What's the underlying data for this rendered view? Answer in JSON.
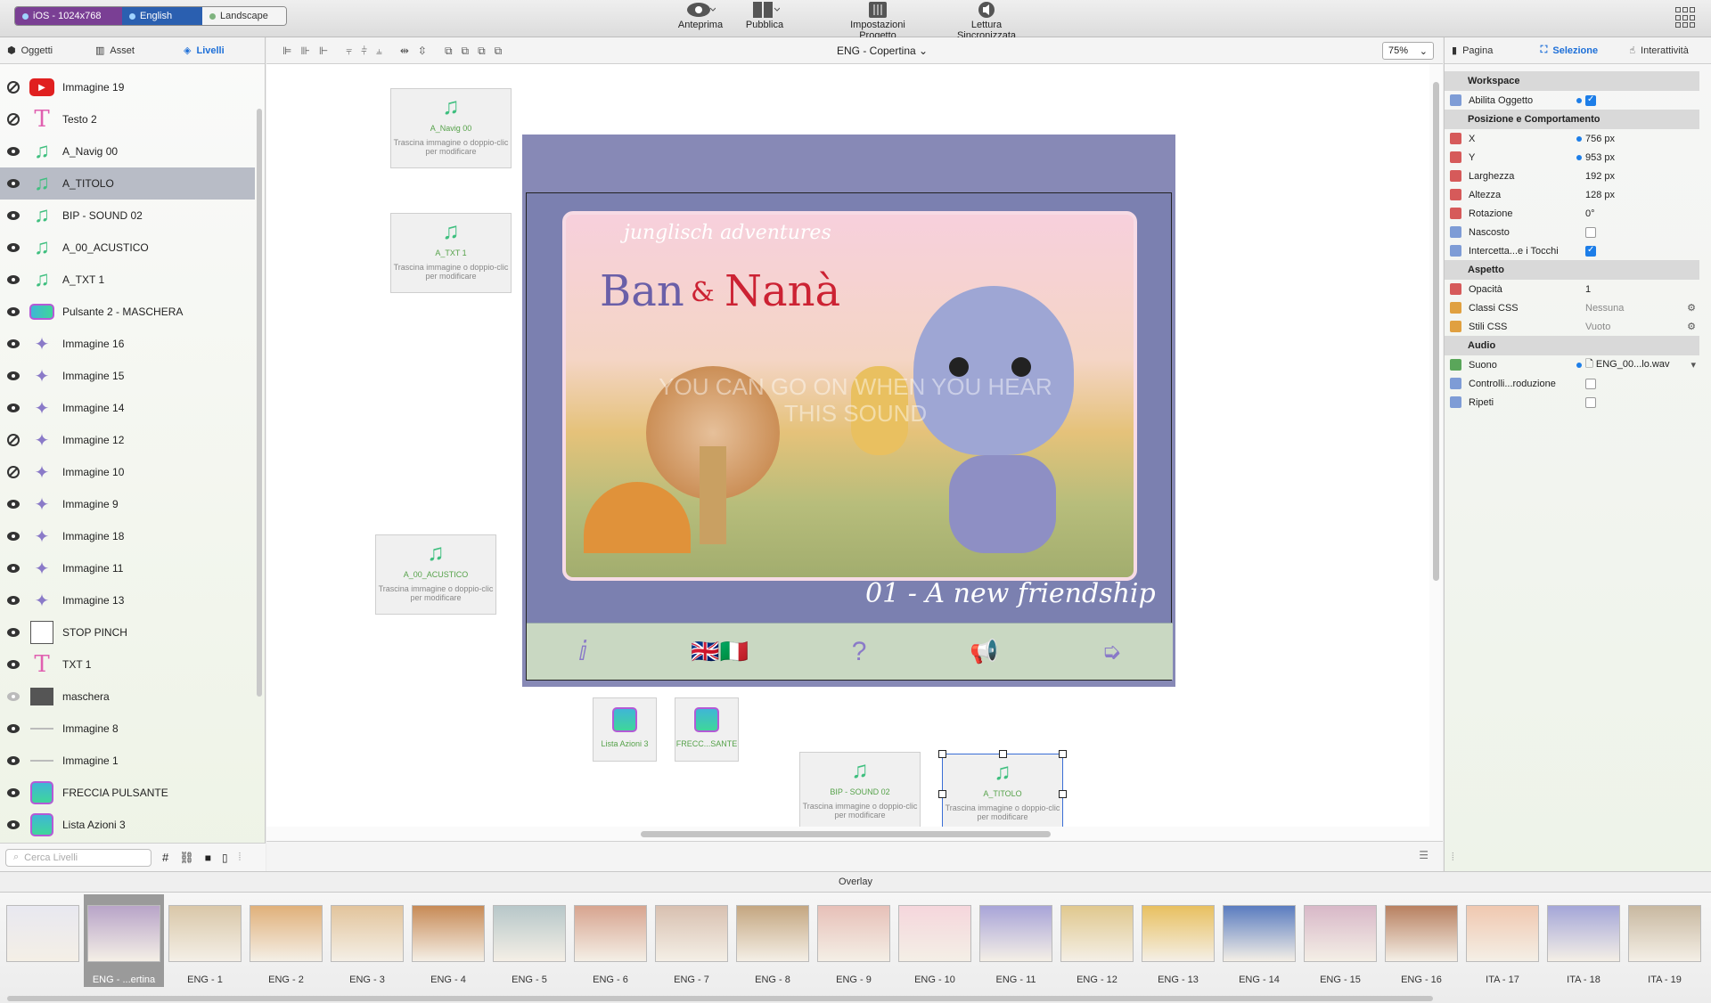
{
  "toolbar": {
    "device": "iOS - 1024x768",
    "language": "English",
    "orientation": "Landscape",
    "preview": "Anteprima",
    "publish": "Pubblica",
    "project_settings": "Impostazioni Progetto",
    "sync_reading": "Lettura Sincronizzata"
  },
  "left_tabs": [
    "Oggetti",
    "Asset",
    "Livelli"
  ],
  "layers": [
    {
      "name": "Immagine 19",
      "type": "youtube",
      "vis": "off"
    },
    {
      "name": "Testo 2",
      "type": "text",
      "vis": "off"
    },
    {
      "name": "A_Navig 00",
      "type": "sound",
      "vis": "on"
    },
    {
      "name": "A_TITOLO",
      "type": "sound",
      "vis": "on",
      "selected": true
    },
    {
      "name": "BIP - SOUND 02",
      "type": "sound",
      "vis": "on"
    },
    {
      "name": "A_00_ACUSTICO",
      "type": "sound",
      "vis": "on"
    },
    {
      "name": "A_TXT 1",
      "type": "sound",
      "vis": "on"
    },
    {
      "name": "Pulsante 2 - MASCHERA",
      "type": "button",
      "vis": "on"
    },
    {
      "name": "Immagine 16",
      "type": "img",
      "vis": "on"
    },
    {
      "name": "Immagine 15",
      "type": "img",
      "vis": "on"
    },
    {
      "name": "Immagine 14",
      "type": "img",
      "vis": "on"
    },
    {
      "name": "Immagine 12",
      "type": "img",
      "vis": "off"
    },
    {
      "name": "Immagine 10",
      "type": "img",
      "vis": "off"
    },
    {
      "name": "Immagine 9",
      "type": "img",
      "vis": "on"
    },
    {
      "name": "Immagine 18",
      "type": "img",
      "vis": "on"
    },
    {
      "name": "Immagine 11",
      "type": "img",
      "vis": "on"
    },
    {
      "name": "Immagine 13",
      "type": "img",
      "vis": "on"
    },
    {
      "name": "STOP PINCH",
      "type": "box",
      "vis": "on"
    },
    {
      "name": "TXT 1",
      "type": "text",
      "vis": "on"
    },
    {
      "name": "maschera",
      "type": "dark",
      "vis": "dim"
    },
    {
      "name": "Immagine 8",
      "type": "line",
      "vis": "on"
    },
    {
      "name": "Immagine 1",
      "type": "line",
      "vis": "on"
    },
    {
      "name": "FRECCIA PULSANTE",
      "type": "list",
      "vis": "on"
    },
    {
      "name": "Lista Azioni 3",
      "type": "list",
      "vis": "on"
    }
  ],
  "search_placeholder": "Cerca Livelli",
  "page_name": "ENG - Copertina",
  "zoom": "75%",
  "widgets": {
    "drop_hint": "Trascina immagine o doppio-clic per modificare",
    "navig": "A_Navig 00",
    "txt1": "A_TXT 1",
    "acustico": "A_00_ACUSTICO",
    "bip": "BIP - SOUND 02",
    "titolo": "A_TITOLO",
    "lista": "Lista Azioni 3",
    "frecc": "FRECC...SANTE"
  },
  "stage": {
    "subtitle": "junglisch adventures",
    "title_left": "Ban",
    "title_amp": "&",
    "title_right": "Nanà",
    "ghost_text": "YOU CAN GO ON WHEN YOU HEAR THIS SOUND",
    "episode": "01 - A new friendship"
  },
  "right_tabs": [
    "Pagina",
    "Selezione",
    "Interattività"
  ],
  "props": {
    "workspace": "Workspace",
    "enable_object": "Abilita Oggetto",
    "position_behaviour": "Posizione e Comportamento",
    "x_label": "X",
    "x_val": "756 px",
    "y_label": "Y",
    "y_val": "953 px",
    "w_label": "Larghezza",
    "w_val": "192 px",
    "h_label": "Altezza",
    "h_val": "128 px",
    "rot_label": "Rotazione",
    "rot_val": "0°",
    "hidden_label": "Nascosto",
    "touch_label": "Intercetta...e i Tocchi",
    "appearance": "Aspetto",
    "opacity_label": "Opacità",
    "opacity_val": "1",
    "css_class_label": "Classi CSS",
    "css_class_val": "Nessuna",
    "css_style_label": "Stili CSS",
    "css_style_val": "Vuoto",
    "audio": "Audio",
    "sound_label": "Suono",
    "sound_val": "ENG_00...lo.wav",
    "controls_label": "Controlli...roduzione",
    "repeat_label": "Ripeti"
  },
  "overlay": "Overlay",
  "pages": [
    "",
    "ENG - ...ertina",
    "ENG - 1",
    "ENG - 2",
    "ENG - 3",
    "ENG - 4",
    "ENG - 5",
    "ENG - 6",
    "ENG - 7",
    "ENG - 8",
    "ENG - 9",
    "ENG - 10",
    "ENG - 11",
    "ENG - 12",
    "ENG - 13",
    "ENG - 14",
    "ENG - 15",
    "ENG - 16",
    "ITA - 17",
    "ITA - 18",
    "ITA - 19"
  ],
  "colors": {
    "accent": "#1d7ee8",
    "device_seg": "#7a3f94",
    "lang_seg": "#2a5fb0",
    "stage_bg": "#8789b6"
  }
}
